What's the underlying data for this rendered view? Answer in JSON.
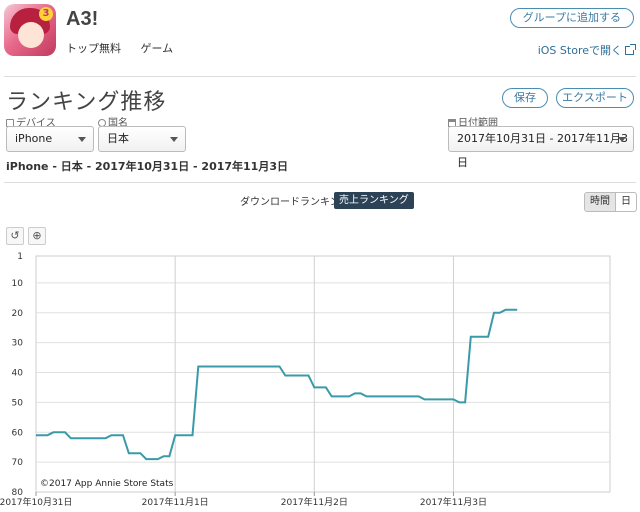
{
  "app": {
    "title": "A3!",
    "category_rank": "トップ無料",
    "genre": "ゲーム",
    "icon_badge": "3",
    "add_group_label": "グループに追加する",
    "ios_store_link": "iOS Storeで開く"
  },
  "section": {
    "title": "ランキング推移",
    "save_label": "保存",
    "export_label": "エクスポート"
  },
  "filters": {
    "device_label": "デバイス",
    "device_value": "iPhone",
    "country_label": "国名",
    "country_value": "日本",
    "date_label": "日付範囲",
    "date_value": "2017年10月31日 - 2017年11月3日"
  },
  "summary": "iPhone - 日本 - 2017年10月31日 - 2017年11月3日",
  "ranking_tabs": {
    "download": "ダウンロードランキング",
    "revenue": "売上ランキング"
  },
  "granularity": {
    "hour": "時間",
    "day": "日"
  },
  "tools": {
    "reset_icon": "↺",
    "zoom_icon": "⊕"
  },
  "colors": {
    "line": "#3a9aa8",
    "grid": "#e0e0e0",
    "active_tab": "#2c4257"
  },
  "chart_data": {
    "type": "line",
    "title": "",
    "xlabel": "",
    "ylabel": "",
    "credit": "©2017 App Annie Store Stats",
    "y_inverted": true,
    "ylim": [
      1,
      80
    ],
    "yticks": [
      1,
      10,
      20,
      30,
      40,
      50,
      60,
      70,
      80
    ],
    "ytick_labels": [
      "1",
      "10",
      "20",
      "30",
      "40",
      "50",
      "60",
      "70",
      "80"
    ],
    "x_unit": "hours since 2017-10-31 00:00",
    "xlim": [
      0,
      99
    ],
    "xticks": [
      0,
      24,
      48,
      72
    ],
    "xtick_labels": [
      "2017年10月31日",
      "2017年11月1日",
      "2017年11月2日",
      "2017年11月3日"
    ],
    "series": [
      {
        "name": "",
        "points": [
          [
            0,
            61
          ],
          [
            2,
            61
          ],
          [
            3,
            60
          ],
          [
            5,
            60
          ],
          [
            6,
            62
          ],
          [
            12,
            62
          ],
          [
            13,
            61
          ],
          [
            15,
            61
          ],
          [
            16,
            67
          ],
          [
            18,
            67
          ],
          [
            19,
            69
          ],
          [
            21,
            69
          ],
          [
            22,
            68
          ],
          [
            23,
            68
          ],
          [
            24,
            61
          ],
          [
            27,
            61
          ],
          [
            28,
            38
          ],
          [
            42,
            38
          ],
          [
            43,
            41
          ],
          [
            47,
            41
          ],
          [
            48,
            45
          ],
          [
            50,
            45
          ],
          [
            51,
            48
          ],
          [
            54,
            48
          ],
          [
            55,
            47
          ],
          [
            56,
            47
          ],
          [
            57,
            48
          ],
          [
            66,
            48
          ],
          [
            67,
            49
          ],
          [
            72,
            49
          ],
          [
            73,
            50
          ],
          [
            74,
            50
          ],
          [
            75,
            28
          ],
          [
            78,
            28
          ],
          [
            79,
            20
          ],
          [
            80,
            20
          ],
          [
            81,
            19
          ],
          [
            83,
            19
          ]
        ]
      }
    ]
  }
}
